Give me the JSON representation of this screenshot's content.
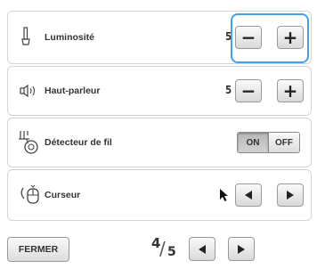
{
  "settings": {
    "brightness": {
      "label": "Luminosité",
      "value": "5",
      "minus": "−",
      "plus": "+"
    },
    "speaker": {
      "label": "Haut-parleur",
      "value": "5",
      "minus": "−",
      "plus": "+"
    },
    "thread_sensor": {
      "label": "Détecteur de fil",
      "on": "ON",
      "off": "OFF",
      "selected": "ON"
    },
    "cursor": {
      "label": "Curseur"
    }
  },
  "footer": {
    "close_label": "FERMER",
    "page_current": "4",
    "page_total": "5"
  },
  "colors": {
    "focus": "#4a9ee8"
  }
}
